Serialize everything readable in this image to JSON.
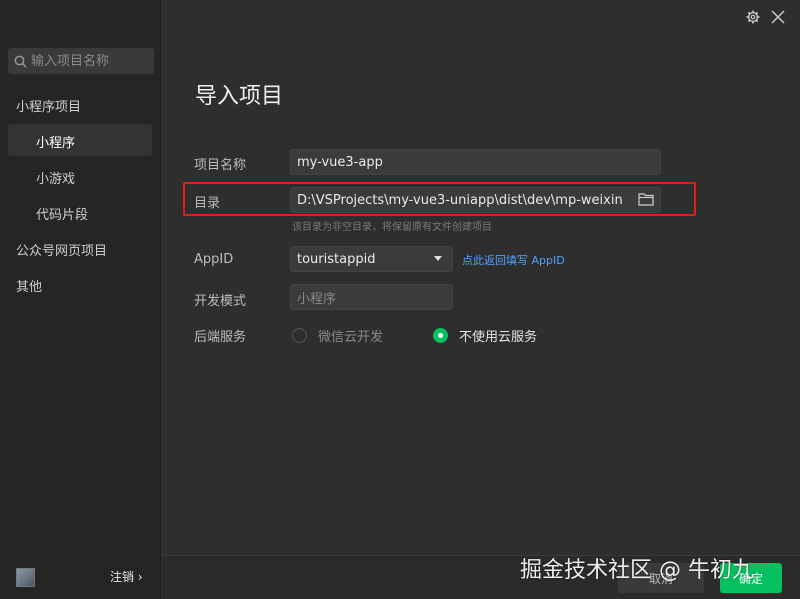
{
  "sidebar": {
    "search_placeholder": "输入项目名称",
    "groups": [
      {
        "label": "小程序项目"
      },
      {
        "label": "公众号网页项目"
      },
      {
        "label": "其他"
      }
    ],
    "sub_items": [
      {
        "label": "小程序",
        "active": true
      },
      {
        "label": "小游戏",
        "active": false
      },
      {
        "label": "代码片段",
        "active": false
      }
    ],
    "logout_label": "注销",
    "logout_chevron": "›"
  },
  "header": {
    "settings_icon": "gear-icon",
    "close_icon": "close-icon"
  },
  "main": {
    "title": "导入项目",
    "project_name": {
      "label": "项目名称",
      "value": "my-vue3-app"
    },
    "directory": {
      "label": "目录",
      "value": "D:\\VSProjects\\my-vue3-uniapp\\dist\\dev\\mp-weixin",
      "hint": "该目录为非空目录，将保留原有文件创建项目",
      "icon": "folder-icon"
    },
    "appid": {
      "label": "AppID",
      "value": "touristappid",
      "link": "点此返回填写 AppID"
    },
    "dev_mode": {
      "label": "开发模式",
      "value": "小程序"
    },
    "backend": {
      "label": "后端服务",
      "options": [
        {
          "label": "微信云开发",
          "checked": false
        },
        {
          "label": "不使用云服务",
          "checked": true
        }
      ]
    }
  },
  "footer": {
    "cancel_label": "取消",
    "ok_label": "确定"
  },
  "watermark": "掘金技术社区 @ 牛初九",
  "colors": {
    "accent": "#07c160",
    "highlight_border": "#e01e1e",
    "link": "#4fa3ff"
  }
}
